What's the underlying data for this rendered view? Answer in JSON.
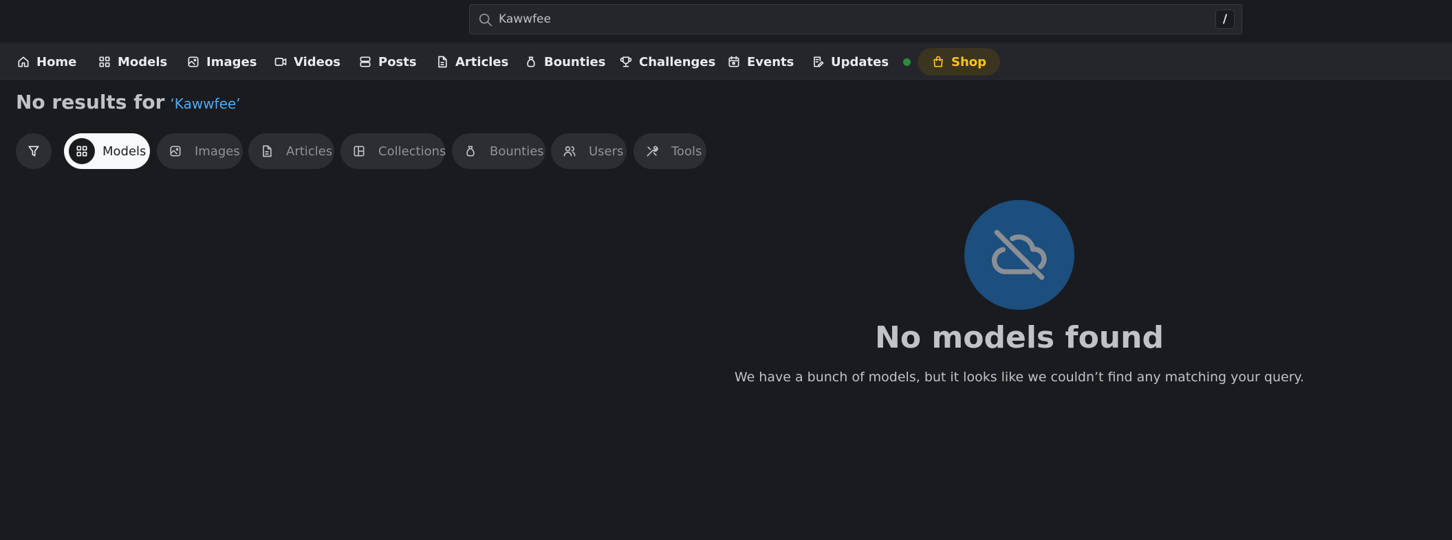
{
  "search": {
    "value": "Kawwfee",
    "shortcut": "/"
  },
  "nav": [
    {
      "label": "Home",
      "icon": "home-icon"
    },
    {
      "label": "Models",
      "icon": "grid-icon"
    },
    {
      "label": "Images",
      "icon": "image-icon"
    },
    {
      "label": "Videos",
      "icon": "video-icon"
    },
    {
      "label": "Posts",
      "icon": "stack-icon"
    },
    {
      "label": "Articles",
      "icon": "document-icon"
    },
    {
      "label": "Bounties",
      "icon": "moneybag-icon"
    },
    {
      "label": "Challenges",
      "icon": "trophy-icon"
    },
    {
      "label": "Events",
      "icon": "calendar-icon"
    },
    {
      "label": "Updates",
      "icon": "edit-document-icon"
    },
    {
      "label": "Shop",
      "icon": "shopping-bag-icon"
    }
  ],
  "results": {
    "prefix": "No results for",
    "query": "‘Kawwfee’"
  },
  "chips": [
    {
      "label": "Models",
      "icon": "grid-icon",
      "active": true
    },
    {
      "label": "Images",
      "icon": "image-icon",
      "active": false
    },
    {
      "label": "Articles",
      "icon": "document-icon",
      "active": false
    },
    {
      "label": "Collections",
      "icon": "layout-icon",
      "active": false
    },
    {
      "label": "Bounties",
      "icon": "moneybag-icon",
      "active": false
    },
    {
      "label": "Users",
      "icon": "users-icon",
      "active": false
    },
    {
      "label": "Tools",
      "icon": "tools-icon",
      "active": false
    }
  ],
  "empty": {
    "icon": "cloud-off-icon",
    "title": "No models found",
    "text": "We have a bunch of models, but it looks like we couldn’t find any matching your query."
  },
  "colors": {
    "accent": "#4dabf7",
    "shop": "#fcc419",
    "updates_dot": "#2b8a3e",
    "empty_circle": "#1c4e7e"
  }
}
